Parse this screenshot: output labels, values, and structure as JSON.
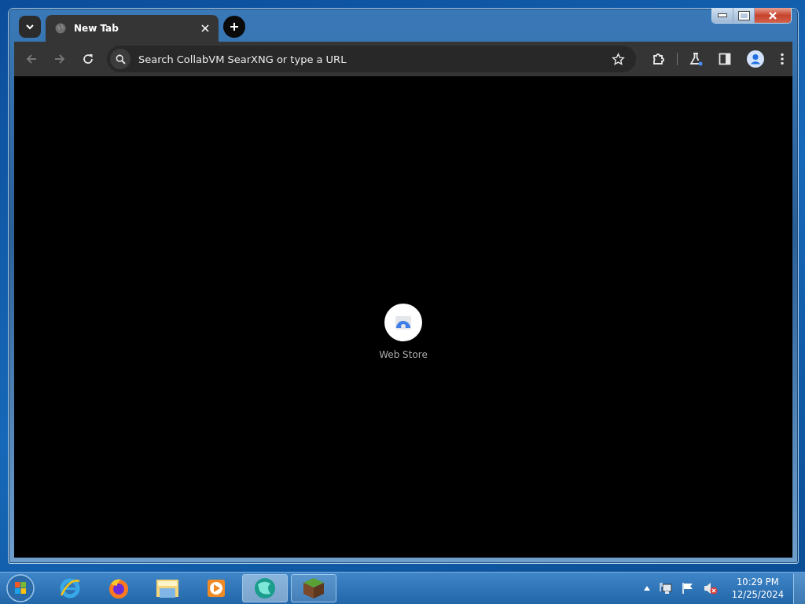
{
  "tab": {
    "title": "New Tab"
  },
  "omnibox": {
    "placeholder": "Search CollabVM SearXNG or type a URL"
  },
  "shortcuts": [
    {
      "label": "Web Store"
    }
  ],
  "taskbar": {
    "apps": [
      {
        "kind": "ie",
        "running": false,
        "selected": false
      },
      {
        "kind": "firefox",
        "running": false,
        "selected": false
      },
      {
        "kind": "explorer",
        "running": false,
        "selected": false
      },
      {
        "kind": "media",
        "running": false,
        "selected": false
      },
      {
        "kind": "globe",
        "running": true,
        "selected": true
      },
      {
        "kind": "block",
        "running": true,
        "selected": false
      }
    ],
    "clock": {
      "time": "10:29 PM",
      "date": "12/25/2024"
    }
  }
}
